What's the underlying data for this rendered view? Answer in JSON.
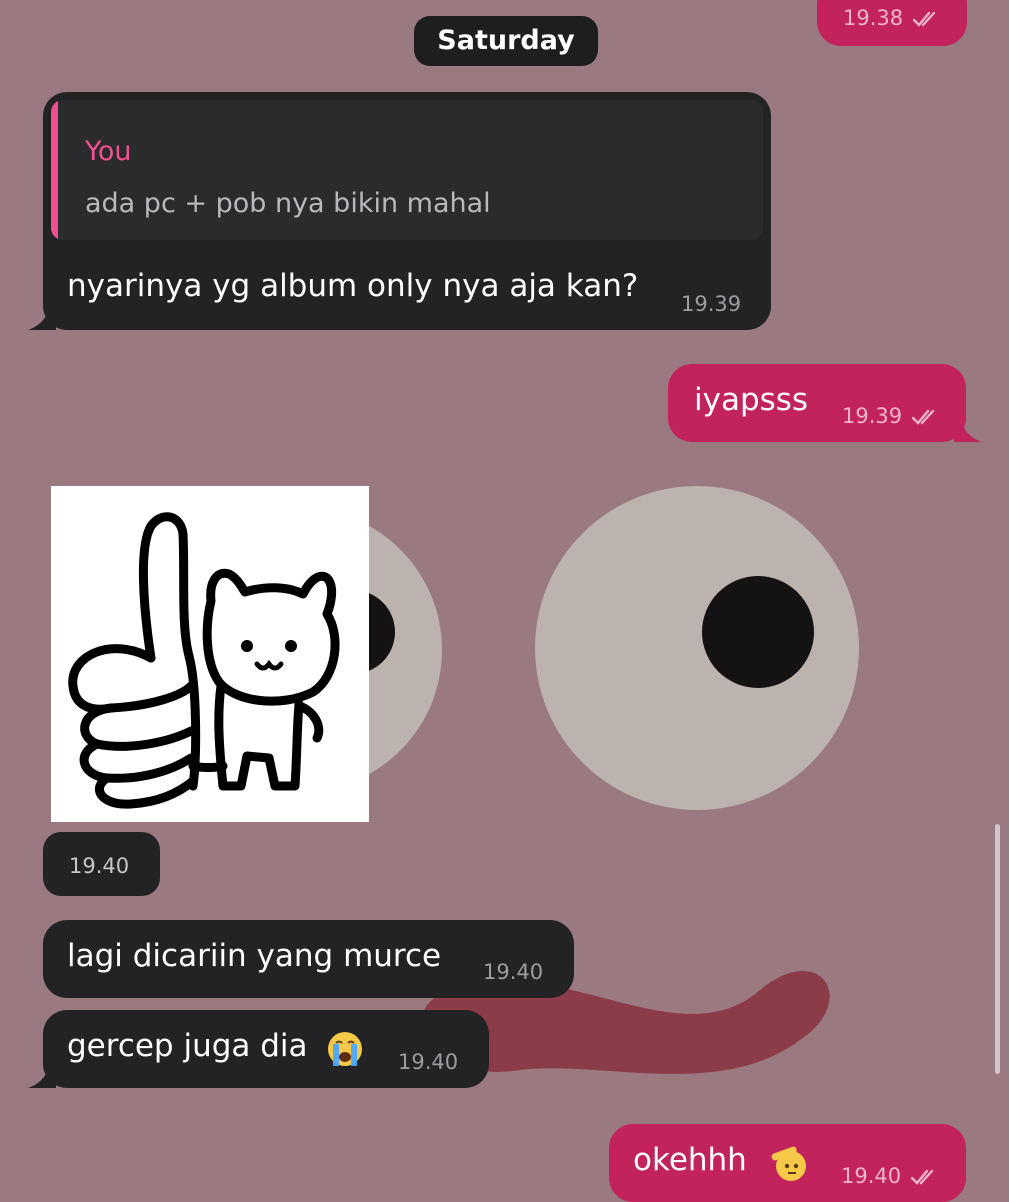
{
  "date_separator": "Saturday",
  "messages": [
    {
      "id": "m0",
      "direction": "out",
      "time": "19.38",
      "status": "read"
    },
    {
      "id": "m1",
      "direction": "in",
      "reply_to": {
        "author": "You",
        "text": "ada pc + pob nya bikin mahal"
      },
      "text": "nyarinya yg album only nya aja kan?",
      "time": "19.39"
    },
    {
      "id": "m2",
      "direction": "out",
      "text": "iyapsss",
      "time": "19.39",
      "status": "read"
    },
    {
      "id": "m3",
      "direction": "in",
      "type": "sticker",
      "sticker": "thumbs-up-cat-sticker",
      "time": "19.40"
    },
    {
      "id": "m4",
      "direction": "in",
      "text": "lagi dicariin yang murce",
      "time": "19.40"
    },
    {
      "id": "m5",
      "direction": "in",
      "text": "gercep juga dia",
      "emoji": "crying-face-emoji",
      "time": "19.40"
    },
    {
      "id": "m6",
      "direction": "out",
      "text": "okehhh",
      "emoji": "saluting-face-emoji",
      "time": "19.40",
      "status": "read"
    }
  ],
  "colors": {
    "incoming": "#232225",
    "outgoing": "#c2235d",
    "reply_accent": "#f0508f",
    "wallpaper": "#9a7a80"
  }
}
